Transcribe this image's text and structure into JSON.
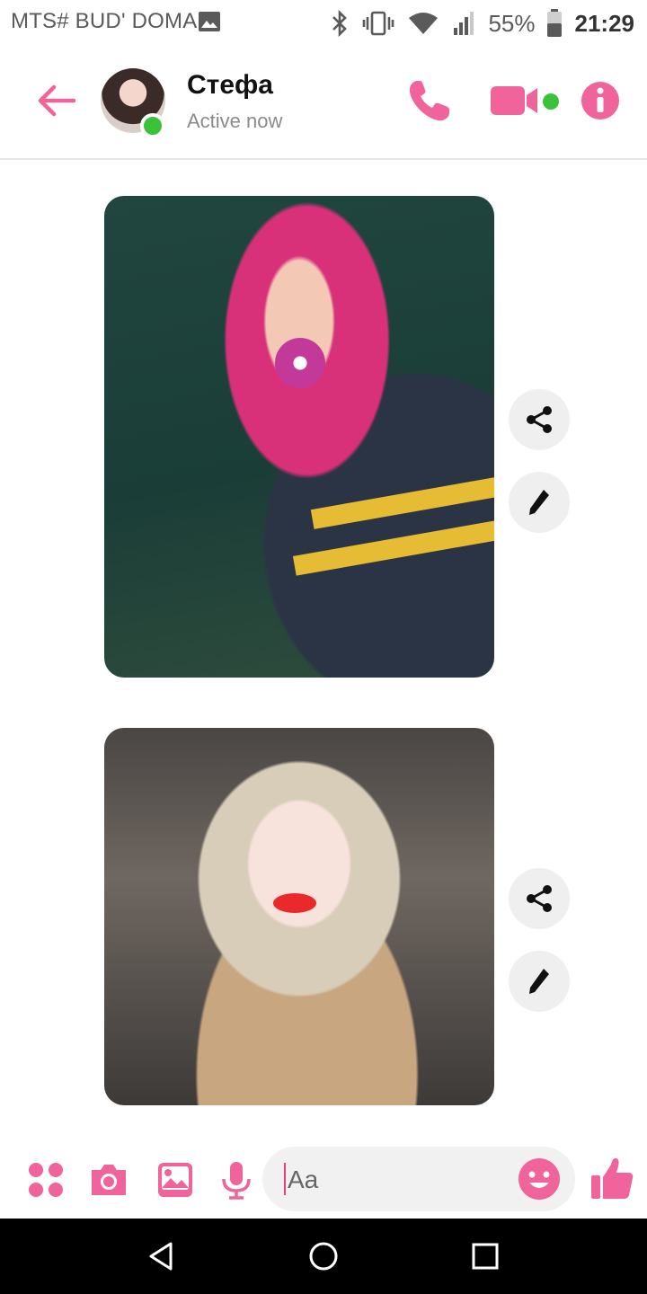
{
  "status_bar": {
    "carrier": "MTS# BUD' DOMA",
    "battery": "55%",
    "time": "21:29",
    "icons": [
      "image-icon",
      "bluetooth-icon",
      "vibrate-icon",
      "wifi-icon",
      "signal-icon",
      "battery-icon"
    ]
  },
  "header": {
    "contact_name": "Стефа",
    "status": "Active now",
    "icons": [
      "back-arrow-icon",
      "phone-icon",
      "video-icon",
      "info-icon"
    ]
  },
  "messages": [
    {
      "type": "photo",
      "actions": [
        "share-icon",
        "edit-icon"
      ]
    },
    {
      "type": "photo",
      "actions": [
        "share-icon",
        "edit-icon"
      ]
    }
  ],
  "composer": {
    "placeholder": "Aa",
    "icons": [
      "apps-icon",
      "camera-icon",
      "gallery-icon",
      "microphone-icon",
      "emoji-icon",
      "thumbs-up-icon"
    ]
  },
  "colors": {
    "accent": "#f0639b",
    "online": "#3cc13b"
  }
}
